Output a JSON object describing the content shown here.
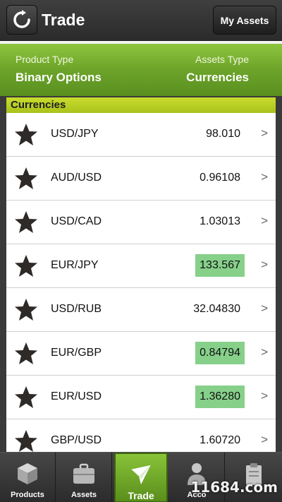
{
  "header": {
    "title": "Trade",
    "my_assets_label": "My Assets"
  },
  "selector": {
    "product_type_label": "Product Type",
    "product_type_value": "Binary Options",
    "assets_type_label": "Assets Type",
    "assets_type_value": "Currencies"
  },
  "section": {
    "title": "Currencies"
  },
  "rows": [
    {
      "pair": "USD/JPY",
      "price": "98.010",
      "highlight": false
    },
    {
      "pair": "AUD/USD",
      "price": "0.96108",
      "highlight": false
    },
    {
      "pair": "USD/CAD",
      "price": "1.03013",
      "highlight": false
    },
    {
      "pair": "EUR/JPY",
      "price": "133.567",
      "highlight": true
    },
    {
      "pair": "USD/RUB",
      "price": "32.04830",
      "highlight": false
    },
    {
      "pair": "EUR/GBP",
      "price": "0.84794",
      "highlight": true
    },
    {
      "pair": "EUR/USD",
      "price": "1.36280",
      "highlight": true
    },
    {
      "pair": "GBP/USD",
      "price": "1.60720",
      "highlight": false
    }
  ],
  "chevron": ">",
  "nav": [
    {
      "label": "Products",
      "icon": "cube-icon"
    },
    {
      "label": "Assets",
      "icon": "briefcase-icon"
    },
    {
      "label": "Trade",
      "icon": "paper-plane-icon"
    },
    {
      "label": "Acco",
      "icon": "person-icon"
    },
    {
      "label": "",
      "icon": "clipboard-icon"
    }
  ],
  "watermark": "11684.com",
  "colors": {
    "accent_green": "#6ca42a",
    "section_yellow": "#b5cc22",
    "highlight_price": "#86d08a"
  }
}
